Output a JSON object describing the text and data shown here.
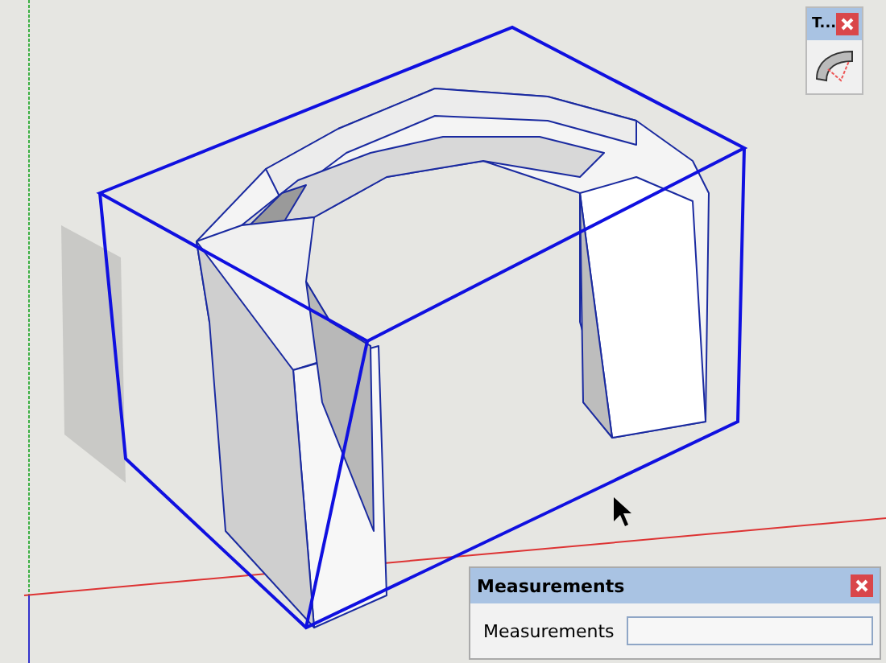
{
  "toolbar_window": {
    "title": "T..."
  },
  "measurements_window": {
    "title": "Measurements",
    "label": "Measurements"
  }
}
